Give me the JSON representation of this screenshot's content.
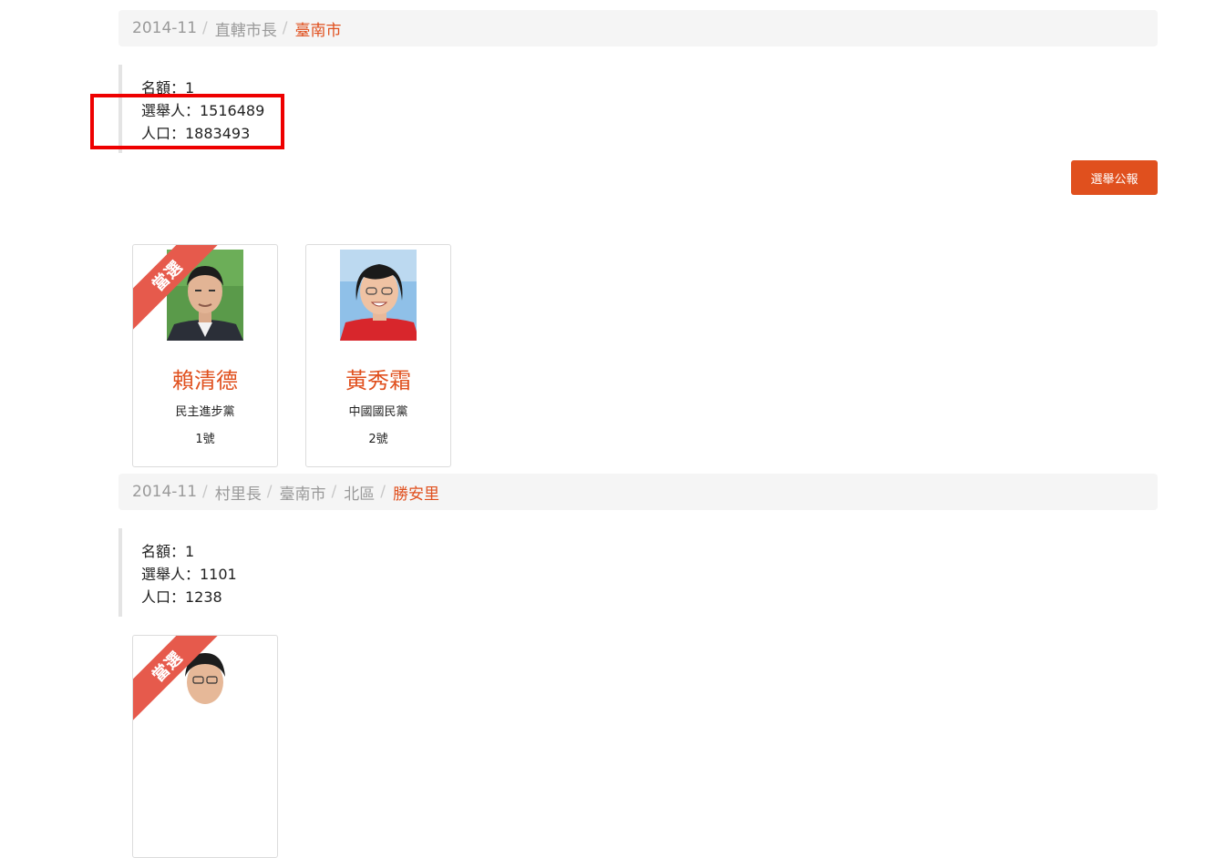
{
  "section1": {
    "breadcrumb": [
      "2014-11",
      "直轄市長",
      "臺南市"
    ],
    "info": {
      "seats": "名額：1",
      "voters": "選舉人：1516489",
      "population": "人口：1883493"
    },
    "bulletin_button": "選舉公報",
    "candidates": [
      {
        "name": "賴清德",
        "party": "民主進步黨",
        "number": "1號",
        "elected_label": "當選"
      },
      {
        "name": "黃秀霜",
        "party": "中國國民黨",
        "number": "2號"
      }
    ]
  },
  "section2": {
    "breadcrumb": [
      "2014-11",
      "村里長",
      "臺南市",
      "北區",
      "勝安里"
    ],
    "info": {
      "seats": "名額：1",
      "voters": "選舉人：1101",
      "population": "人口：1238"
    },
    "candidates": [
      {
        "elected_label": "當選"
      }
    ]
  },
  "colors": {
    "accent": "#e0501e",
    "ribbon": "#e65a4c",
    "highlight": "#ee0000",
    "breadcrumb_bg": "#f5f5f5"
  }
}
